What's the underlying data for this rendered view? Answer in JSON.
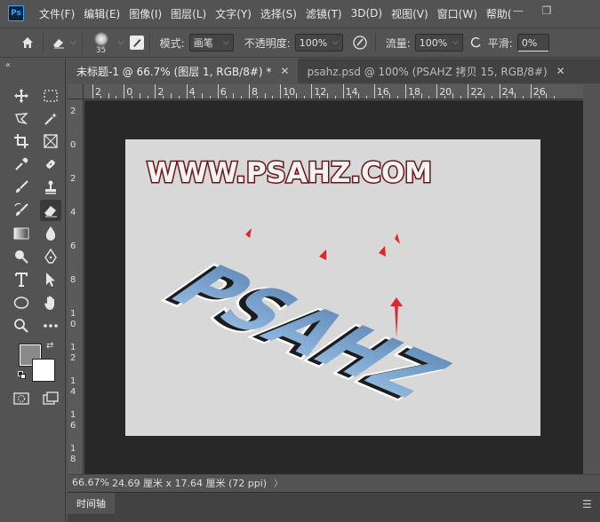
{
  "menu": [
    "文件(F)",
    "编辑(E)",
    "图像(I)",
    "图层(L)",
    "文字(Y)",
    "选择(S)",
    "滤镜(T)",
    "3D(D)",
    "视图(V)",
    "窗口(W)",
    "帮助("
  ],
  "window_controls": {
    "minimize": "—",
    "restore": "❐"
  },
  "options": {
    "brush_size": "35",
    "mode_label": "模式:",
    "mode_value": "画笔",
    "opacity_label": "不透明度:",
    "opacity_value": "100%",
    "flow_label": "流量:",
    "flow_value": "100%",
    "smoothing_label": "平滑:",
    "smoothing_value": "0%"
  },
  "tabs": [
    {
      "label": "未标题-1 @ 66.7% (图层 1, RGB/8#) *",
      "active": true
    },
    {
      "label": "psahz.psd @ 100% (PSAHZ 拷贝 15, RGB/8#)",
      "active": false
    }
  ],
  "ruler_top": [
    "2",
    "0",
    "2",
    "4",
    "6",
    "8",
    "10",
    "12",
    "14",
    "16",
    "18",
    "20",
    "22",
    "24",
    "26"
  ],
  "ruler_left": [
    [
      "2"
    ],
    [
      "0"
    ],
    [
      "2"
    ],
    [
      "4"
    ],
    [
      "6"
    ],
    [
      "8"
    ],
    [
      "1",
      "0"
    ],
    [
      "1",
      "2"
    ],
    [
      "1",
      "4"
    ],
    [
      "1",
      "6"
    ],
    [
      "1",
      "8"
    ]
  ],
  "canvas": {
    "watermark": "WWW.PSAHZ.COM",
    "art_text": "PSAHZ",
    "colors": {
      "background": "#d8d8d8",
      "pasteboard": "#282828",
      "arrow": "#e0262b",
      "inner": "#7aa8d6",
      "watermark_outline": "#6b1414"
    }
  },
  "status": {
    "zoom": "66.67%",
    "info": "24.69 厘米 x 17.64 厘米 (72 ppi)",
    "arrow": "〉"
  },
  "timeline": {
    "label": "时间轴"
  },
  "colors": {
    "foreground": "#8a8a8a",
    "background": "#ffffff",
    "ui": "#535353",
    "accent": "#31a8ff"
  }
}
